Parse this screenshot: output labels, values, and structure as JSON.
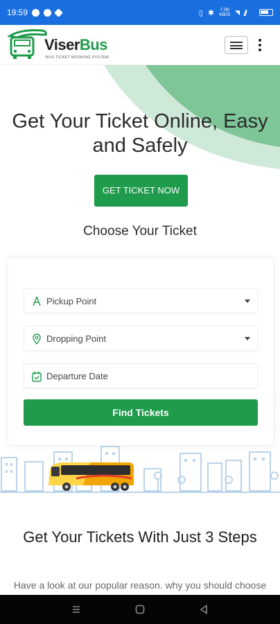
{
  "status_bar": {
    "time": "19:59",
    "network_speed": "7.00\nKB/S",
    "battery": "80"
  },
  "app": {
    "brand_primary": "Viser",
    "brand_secondary": "Bus",
    "tagline": "BUS TICKET BOOKING SYSTEM",
    "accent_color": "#1e9b4b"
  },
  "hero": {
    "title": "Get Your Ticket Online, Easy and Safely",
    "cta_label": "GET TICKET NOW",
    "subtitle": "Choose Your Ticket"
  },
  "form": {
    "pickup_label": "Pickup Point",
    "dropping_label": "Dropping Point",
    "date_label": "Departure Date",
    "submit_label": "Find Tickets",
    "icons": [
      "pickup-icon",
      "location-pin-icon",
      "calendar-check-icon"
    ]
  },
  "steps": {
    "title": "Get Your Tickets With Just 3 Steps",
    "description": "Have a look at our popular reason. why you should choose"
  }
}
